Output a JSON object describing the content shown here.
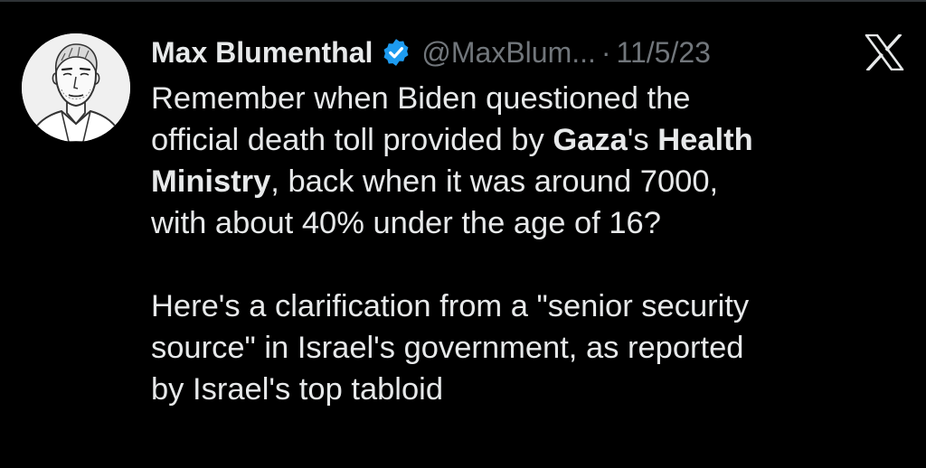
{
  "tweet": {
    "author": {
      "display_name": "Max Blumenthal",
      "handle": "@MaxBlum...",
      "verified_color": "#1d9bf0",
      "avatar_icon": "sketch-portrait-avatar"
    },
    "separator": "·",
    "date": "11/5/23",
    "platform_icon": "x-logo-icon",
    "body": {
      "p1_l1": "Remember when Biden questioned the",
      "p1_l2_a": "official death toll provided by ",
      "p1_l2_b": "Gaza",
      "p1_l2_c": "'s ",
      "p1_l2_d": "Health",
      "p1_l3_a": "Ministry",
      "p1_l3_b": ", back when it was around 7000,",
      "p1_l4": "with about 40% under the age of 16?",
      "p2_l1": "Here's a clarification from a \"senior security",
      "p2_l2": "source\" in Israel's government, as reported",
      "p2_l3": "by Israel's top tabloid"
    }
  },
  "colors": {
    "background": "#000000",
    "text": "#e7e9ea",
    "muted": "#71767b",
    "verified": "#1d9bf0"
  }
}
